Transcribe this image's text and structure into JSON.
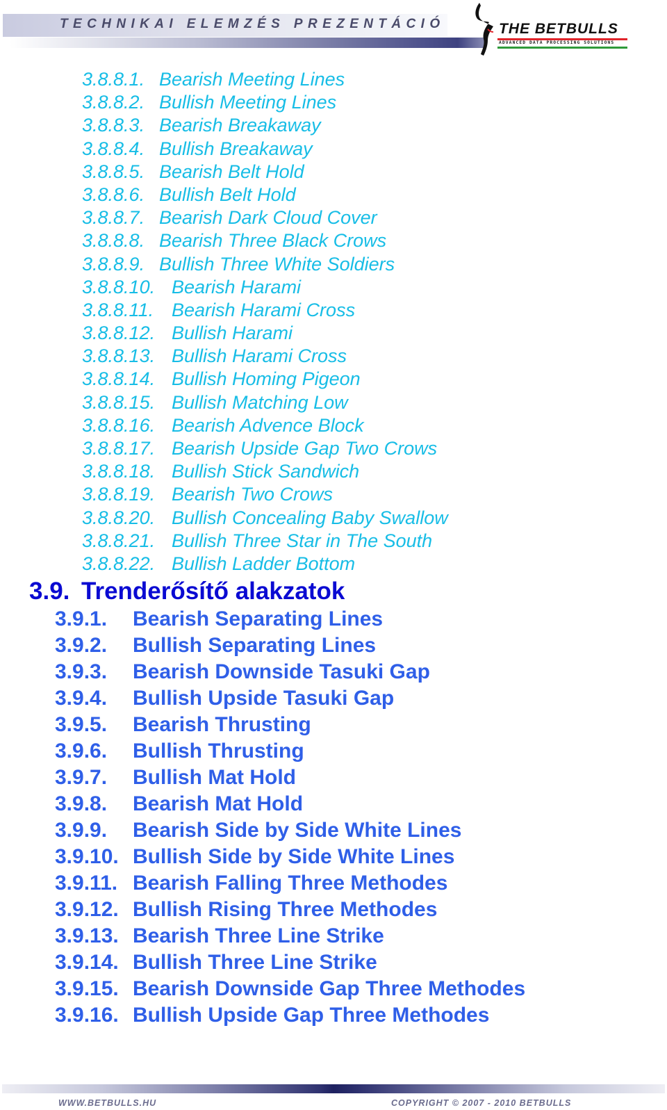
{
  "header": {
    "title": "TECHNIKAI ELEMZÉS PREZENTÁCIÓ",
    "logo": {
      "icon": "bull-horn-icon",
      "name": "THE BETBULLS",
      "tagline": "ADVANCED DATA PROCESSING SOLUTIONS"
    }
  },
  "colors": {
    "level4_text": "#17bde6",
    "section_heading": "#0a0ad2",
    "level3_text": "#2f5fe8",
    "header_text": "#4a4b6a",
    "footer_text": "#6b6c8e"
  },
  "toc": {
    "level4_items": [
      {
        "num": "3.8.8.1.",
        "title": "Bearish Meeting Lines"
      },
      {
        "num": "3.8.8.2.",
        "title": "Bullish Meeting Lines"
      },
      {
        "num": "3.8.8.3.",
        "title": "Bearish Breakaway"
      },
      {
        "num": "3.8.8.4.",
        "title": "Bullish Breakaway"
      },
      {
        "num": "3.8.8.5.",
        "title": "Bearish Belt Hold"
      },
      {
        "num": "3.8.8.6.",
        "title": "Bullish Belt Hold"
      },
      {
        "num": "3.8.8.7.",
        "title": "Bearish Dark Cloud Cover"
      },
      {
        "num": "3.8.8.8.",
        "title": "Bearish Three Black Crows"
      },
      {
        "num": "3.8.8.9.",
        "title": "Bullish Three White Soldiers"
      },
      {
        "num": "3.8.8.10.",
        "title": "Bearish Harami"
      },
      {
        "num": "3.8.8.11.",
        "title": "Bearish Harami Cross"
      },
      {
        "num": "3.8.8.12.",
        "title": "Bullish Harami"
      },
      {
        "num": "3.8.8.13.",
        "title": "Bullish Harami Cross"
      },
      {
        "num": "3.8.8.14.",
        "title": "Bullish Homing Pigeon"
      },
      {
        "num": "3.8.8.15.",
        "title": "Bullish Matching Low"
      },
      {
        "num": "3.8.8.16.",
        "title": "Bearish Advence Block"
      },
      {
        "num": "3.8.8.17.",
        "title": "Bearish Upside Gap Two Crows"
      },
      {
        "num": "3.8.8.18.",
        "title": "Bullish Stick Sandwich"
      },
      {
        "num": "3.8.8.19.",
        "title": "Bearish Two Crows"
      },
      {
        "num": "3.8.8.20.",
        "title": "Bullish Concealing Baby Swallow"
      },
      {
        "num": "3.8.8.21.",
        "title": "Bullish Three Star in The South"
      },
      {
        "num": "3.8.8.22.",
        "title": "Bullish Ladder Bottom"
      }
    ],
    "section": {
      "num": "3.9.",
      "title": "Trenderősítő alakzatok"
    },
    "level3_items": [
      {
        "num": "3.9.1.",
        "title": "Bearish Separating Lines"
      },
      {
        "num": "3.9.2.",
        "title": "Bullish Separating Lines"
      },
      {
        "num": "3.9.3.",
        "title": "Bearish Downside Tasuki Gap"
      },
      {
        "num": "3.9.4.",
        "title": "Bullish Upside Tasuki Gap"
      },
      {
        "num": "3.9.5.",
        "title": "Bearish Thrusting"
      },
      {
        "num": "3.9.6.",
        "title": "Bullish Thrusting"
      },
      {
        "num": "3.9.7.",
        "title": "Bullish Mat Hold"
      },
      {
        "num": "3.9.8.",
        "title": "Bearish Mat Hold"
      },
      {
        "num": "3.9.9.",
        "title": "Bearish Side by Side White Lines"
      },
      {
        "num": "3.9.10.",
        "title": "Bullish Side by Side White Lines"
      },
      {
        "num": "3.9.11.",
        "title": "Bearish Falling Three Methodes"
      },
      {
        "num": "3.9.12.",
        "title": "Bullish Rising Three Methodes"
      },
      {
        "num": "3.9.13.",
        "title": "Bearish Three Line Strike"
      },
      {
        "num": "3.9.14.",
        "title": "Bullish Three Line Strike"
      },
      {
        "num": "3.9.15.",
        "title": "Bearish Downside Gap Three Methodes"
      },
      {
        "num": "3.9.16.",
        "title": "Bullish Upside Gap Three Methodes"
      }
    ]
  },
  "footer": {
    "website": "WWW.BETBULLS.HU",
    "copyright": "COPYRIGHT © 2007 - 2010 BETBULLS"
  }
}
